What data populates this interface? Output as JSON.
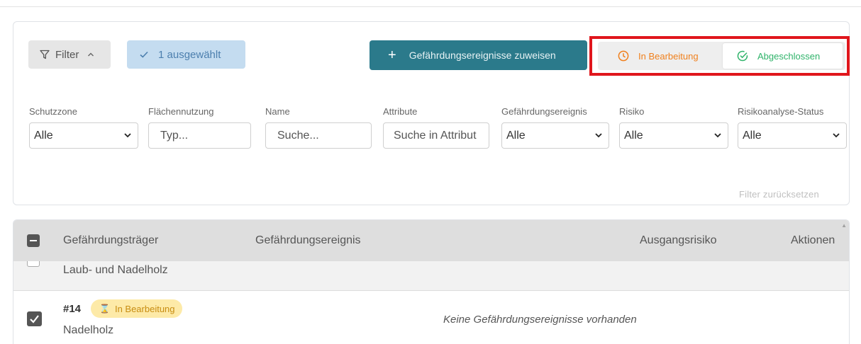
{
  "toolbar": {
    "filter_label": "Filter",
    "selected_label": "1 ausgewählt",
    "assign_label": "Gefährdungsereignisse zuweisen"
  },
  "status_toggle": {
    "in_progress": "In Bearbeitung",
    "completed": "Abgeschlossen",
    "in_progress_color": "#f0801d",
    "completed_color": "#2fb36a",
    "highlight_color": "#e0161c"
  },
  "filters": {
    "schutzzone": {
      "label": "Schutzzone",
      "value": "Alle"
    },
    "flaechennutzung": {
      "label": "Flächennutzung",
      "placeholder": "Typ..."
    },
    "name": {
      "label": "Name",
      "placeholder": "Suche..."
    },
    "attribute": {
      "label": "Attribute",
      "placeholder": "Suche in Attribut"
    },
    "gefaehrdungsereignis": {
      "label": "Gefährdungsereignis",
      "value": "Alle"
    },
    "risiko": {
      "label": "Risiko",
      "value": "Alle"
    },
    "risikoanalyse_status": {
      "label": "Risikoanalyse-Status",
      "value": "Alle"
    },
    "reset_label": "Filter zurücksetzen"
  },
  "table": {
    "columns": [
      "Gefährdungsträger",
      "Gefährdungsereignis",
      "Ausgangsrisiko",
      "Aktionen"
    ],
    "rows": [
      {
        "name": "Laub- und Nadelholz"
      },
      {
        "id": "#14",
        "status": "In Bearbeitung",
        "name": "Nadelholz",
        "events_note": "Keine Gefährdungsereignisse vorhanden"
      }
    ]
  },
  "colors": {
    "primary": "#2b7a8b",
    "selected_bg": "#c4dcf0",
    "badge_bg": "#fdeaa8"
  }
}
